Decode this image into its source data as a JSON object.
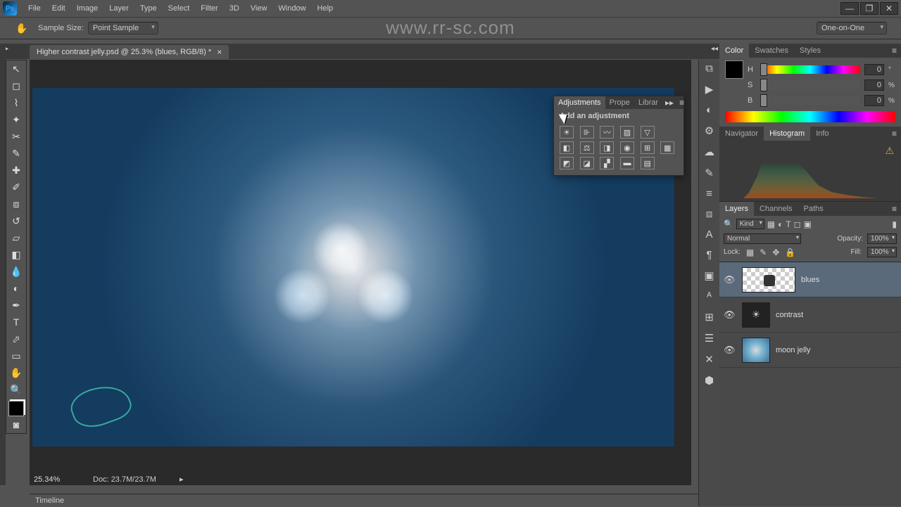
{
  "menu": {
    "items": [
      "File",
      "Edit",
      "Image",
      "Layer",
      "Type",
      "Select",
      "Filter",
      "3D",
      "View",
      "Window",
      "Help"
    ]
  },
  "options": {
    "sample_label": "Sample Size:",
    "sample_value": "Point Sample",
    "workspace": "One-on-One"
  },
  "tab": {
    "title": "Higher contrast jelly.psd @ 25.3% (blues, RGB/8) *"
  },
  "status": {
    "zoom": "25.34%",
    "doc_label": "Doc:",
    "doc_size": "23.7M/23.7M"
  },
  "timeline": {
    "label": "Timeline"
  },
  "watermark": "www.rr-sc.com",
  "adjustments": {
    "tabs": [
      "Adjustments",
      "Prope",
      "Librar"
    ],
    "label": "Add an adjustment"
  },
  "color": {
    "tabs": [
      "Color",
      "Swatches",
      "Styles"
    ],
    "h_label": "H",
    "s_label": "S",
    "b_label": "B",
    "h_val": "0",
    "s_val": "0",
    "b_val": "0",
    "h_unit": "°",
    "s_unit": "%",
    "b_unit": "%"
  },
  "nav": {
    "tabs": [
      "Navigator",
      "Histogram",
      "Info"
    ]
  },
  "layers": {
    "tabs": [
      "Layers",
      "Channels",
      "Paths"
    ],
    "kind_label": "Kind",
    "blend_mode": "Normal",
    "opacity_label": "Opacity:",
    "opacity_val": "100%",
    "lock_label": "Lock:",
    "fill_label": "Fill:",
    "fill_val": "100%",
    "items": [
      {
        "name": "blues",
        "type": "adjustment",
        "visible": true,
        "selected": true
      },
      {
        "name": "contrast",
        "type": "brightness",
        "visible": true,
        "selected": false
      },
      {
        "name": "moon jelly",
        "type": "image",
        "visible": true,
        "selected": false
      }
    ]
  }
}
